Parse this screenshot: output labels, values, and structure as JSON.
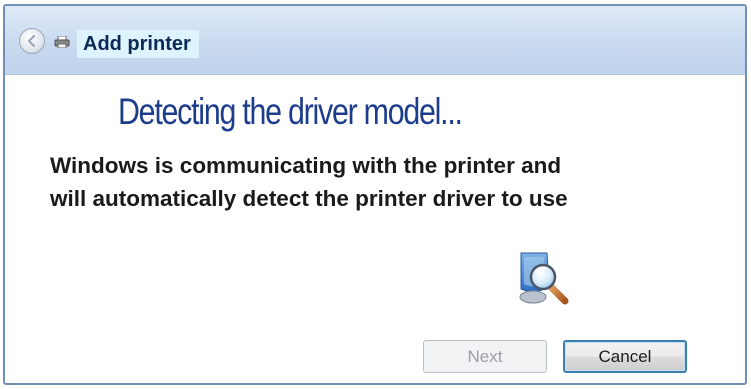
{
  "window": {
    "title": "Add printer",
    "back_icon": "back-arrow-icon",
    "app_icon": "printer-icon"
  },
  "main": {
    "heading": "Detecting the driver model...",
    "description_lines": [
      "Windows is communicating with the printer  and",
      "will automatically detect the printer driver to use"
    ],
    "status_icon": "search-magnifier-icon"
  },
  "footer": {
    "next_label": "Next",
    "next_enabled": false,
    "cancel_label": "Cancel"
  },
  "colors": {
    "heading": "#1d3d8c",
    "titlebar": "#c9daf0",
    "title_highlight": "#ddf3ff",
    "cancel_focus_border": "#3c7fb1"
  }
}
